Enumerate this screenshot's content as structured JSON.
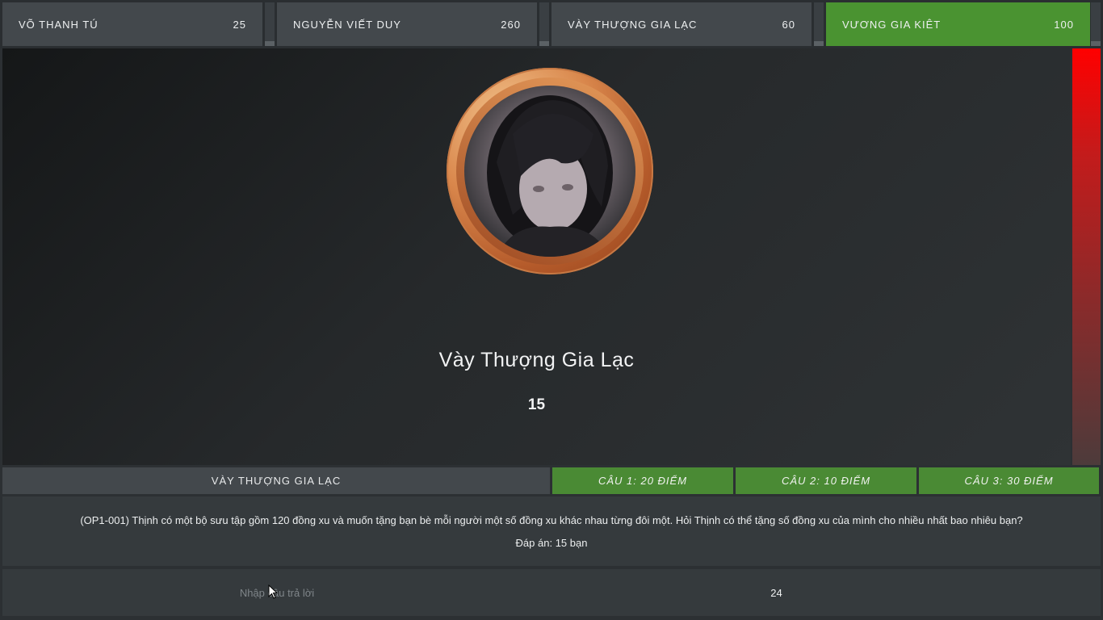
{
  "players": [
    {
      "name": "VÕ THANH TÚ",
      "score": "25",
      "meter_level": 0.12,
      "active": false
    },
    {
      "name": "NGUYỄN VIẾT DUY",
      "score": "260",
      "meter_level": 0.12,
      "active": false
    },
    {
      "name": "VÀY THƯỢNG GIA LẠC",
      "score": "60",
      "meter_level": 0.12,
      "active": false
    },
    {
      "name": "VƯƠNG GIA KIÊT",
      "score": "100",
      "meter_level": 0.12,
      "active": true
    }
  ],
  "colors": {
    "active_player": "#4a9331",
    "question_tab": "#4a8a34",
    "timer_top": "#ff0000",
    "avatar_ring": "#d9874c"
  },
  "timer": {
    "remaining_fraction": 1.0
  },
  "stage": {
    "avatar_icon": "contestant-photo",
    "contestant_name": "Vày Thượng Gia Lạc",
    "contestant_score": "15"
  },
  "question_header": {
    "contestant": "VÀY THƯỢNG GIA LẠC",
    "tabs": [
      {
        "label": "CÂU 1: 20 ĐIỂM"
      },
      {
        "label": "CÂU 2: 10 ĐIỂM"
      },
      {
        "label": "CÂU 3: 30 ĐIỂM"
      }
    ]
  },
  "question": {
    "text": "(OP1-001) Thịnh có một bộ sưu tập gồm 120 đồng xu và muốn tặng bạn bè mỗi người một số đồng xu khác nhau từng đôi một. Hỏi Thịnh có thể tặng số đồng xu của mình cho nhiều nhất bao nhiêu bạn?",
    "answer": "Đáp án: 15 bạn"
  },
  "answer_row": {
    "placeholder": "Nhập câu trả lời",
    "value": "",
    "countdown": "24"
  }
}
